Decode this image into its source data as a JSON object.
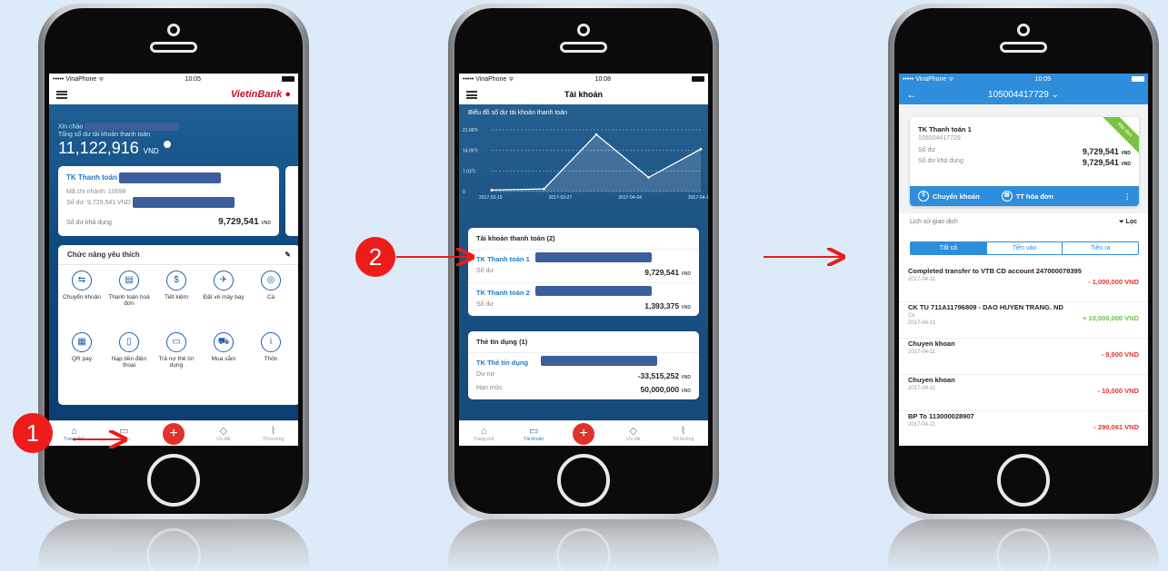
{
  "colors": {
    "brand_red": "#c8102e",
    "brand_blue": "#0a4ea3",
    "accent": "#2f8edb",
    "negative": "#e3342f",
    "positive": "#6cc04a",
    "annotation": "#ee1b1b"
  },
  "steps": [
    "1",
    "2"
  ],
  "screen1": {
    "status": {
      "carrier": "••••• VinaPhone ᯤ",
      "time": "10:05"
    },
    "logo": {
      "part1": "VietinBank",
      "part2": ""
    },
    "greeting": "Xin chào",
    "balance_label": "Tổng số dư tài khoản thanh toán",
    "balance_value": "11,122,916",
    "balance_unit": "VND",
    "card": {
      "title": "TK Thanh toán",
      "branch": "Mã chi nhánh: 10698",
      "balance_line": "Số dư: 9,729,541 VND",
      "available_label": "Số dư khả dụng",
      "available_value": "9,729,541",
      "unit": "VND"
    },
    "favorites": {
      "title": "Chức năng yêu thích",
      "items": [
        {
          "icon": "transfer-icon",
          "glyph": "⇆",
          "label": "Chuyển khoản"
        },
        {
          "icon": "bill-icon",
          "glyph": "▤",
          "label": "Thanh toán hoá đơn"
        },
        {
          "icon": "savings-icon",
          "glyph": "$",
          "label": "Tiết kiệm"
        },
        {
          "icon": "plane-icon",
          "glyph": "✈",
          "label": "Đặt vé máy bay"
        },
        {
          "icon": "more-icon",
          "glyph": "◎",
          "label": "Cà"
        },
        {
          "icon": "qr-icon",
          "glyph": "▦",
          "label": "QR pay"
        },
        {
          "icon": "topup-icon",
          "glyph": "▯",
          "label": "Nạp tiền điện thoại"
        },
        {
          "icon": "card-payment-icon",
          "glyph": "▭",
          "label": "Trả nợ thẻ tín dụng"
        },
        {
          "icon": "cart-icon",
          "glyph": "⛟",
          "label": "Mua sắm"
        },
        {
          "icon": "info-icon",
          "glyph": "i",
          "label": "Thôn"
        }
      ]
    },
    "tabs": [
      {
        "icon": "home-icon",
        "glyph": "⌂",
        "label": "Trang chủ"
      },
      {
        "icon": "accounts-icon",
        "glyph": "▭",
        "label": "khoản"
      },
      {
        "icon": "plus-icon",
        "glyph": "+",
        "label": ""
      },
      {
        "icon": "tag-icon",
        "glyph": "◇",
        "label": "Ưu đãi"
      },
      {
        "icon": "market-icon",
        "glyph": "⌇",
        "label": "Thị trường"
      }
    ]
  },
  "screen2": {
    "status": {
      "carrier": "••••• VinaPhone ᯤ",
      "time": "10:08"
    },
    "title": "Tài khoản",
    "chart_data": {
      "type": "line",
      "title": "Biểu đồ số dư tài khoản thanh toán",
      "x": [
        "2017-03-19",
        "2017-03-27",
        "2017-04-04",
        "2017-04-1"
      ],
      "y_ticks": [
        "21.09Tr",
        "14.06Tr",
        "7.03Tr",
        "0"
      ],
      "series": [
        {
          "values": [
            0.5,
            0.9,
            19.5,
            4.8,
            14.5
          ]
        }
      ],
      "ylim": [
        0,
        21.09
      ]
    },
    "payment": {
      "title": "Tài khoản thanh toán (2)",
      "accounts": [
        {
          "name": "TK Thanh toán 1",
          "label": "Số dư",
          "value": "9,729,541",
          "unit": "VND"
        },
        {
          "name": "TK Thanh toán 2",
          "label": "Số dư",
          "value": "1,393,375",
          "unit": "VND"
        }
      ]
    },
    "credit": {
      "title": "Thẻ tín dụng (1)",
      "name": "TK Thẻ tín dụng",
      "debt_label": "Dư nợ",
      "debt_value": "-33,515,252",
      "limit_label": "Hạn mức",
      "limit_value": "50,000,000",
      "unit": "VND"
    },
    "tabs": [
      {
        "icon": "home-icon",
        "glyph": "⌂",
        "label": "Trang chủ"
      },
      {
        "icon": "accounts-icon",
        "glyph": "▭",
        "label": "Tài khoản"
      },
      {
        "icon": "plus-icon",
        "glyph": "+",
        "label": ""
      },
      {
        "icon": "tag-icon",
        "glyph": "◇",
        "label": "Ưu đãi"
      },
      {
        "icon": "market-icon",
        "glyph": "⌇",
        "label": "Thị trường"
      }
    ]
  },
  "screen3": {
    "status": {
      "carrier": "••••• VinaPhone ᯤ",
      "time": "10:09"
    },
    "account_number": "105004417729",
    "card": {
      "name": "TK Thanh toán 1",
      "number": "105004417729",
      "ribbon": "Mặc định",
      "balance_label": "Số dư",
      "balance_value": "9,729,541",
      "available_label": "Số dư khả dụng",
      "available_value": "9,729,541",
      "unit": "VND",
      "action_transfer": "Chuyển khoản",
      "action_bill": "TT hóa đơn"
    },
    "history_label": "Lịch sử giao dịch",
    "filter_label": "Lọc",
    "segments": [
      "Tất cả",
      "Tiền vào",
      "Tiền ra"
    ],
    "transactions": [
      {
        "desc": "Completed transfer to VTB CD account 247000078395",
        "sub": "",
        "date": "2017-04-11",
        "amount": "- 1,000,000 VND",
        "sign": "neg"
      },
      {
        "desc": "CK TU 711A11796809 - DAO HUYEN TRANG. ND",
        "sub": "Ck",
        "date": "2017-04-11",
        "amount": "+ 10,000,000 VND",
        "sign": "pos"
      },
      {
        "desc": "Chuyen khoan",
        "sub": "",
        "date": "2017-04-11",
        "amount": "- 9,900 VND",
        "sign": "neg"
      },
      {
        "desc": "Chuyen khoan",
        "sub": "",
        "date": "2017-04-11",
        "amount": "- 10,000 VND",
        "sign": "neg"
      },
      {
        "desc": "BP To 113000028907",
        "sub": "",
        "date": "2017-04-11",
        "amount": "- 290,061 VND",
        "sign": "neg"
      }
    ]
  }
}
